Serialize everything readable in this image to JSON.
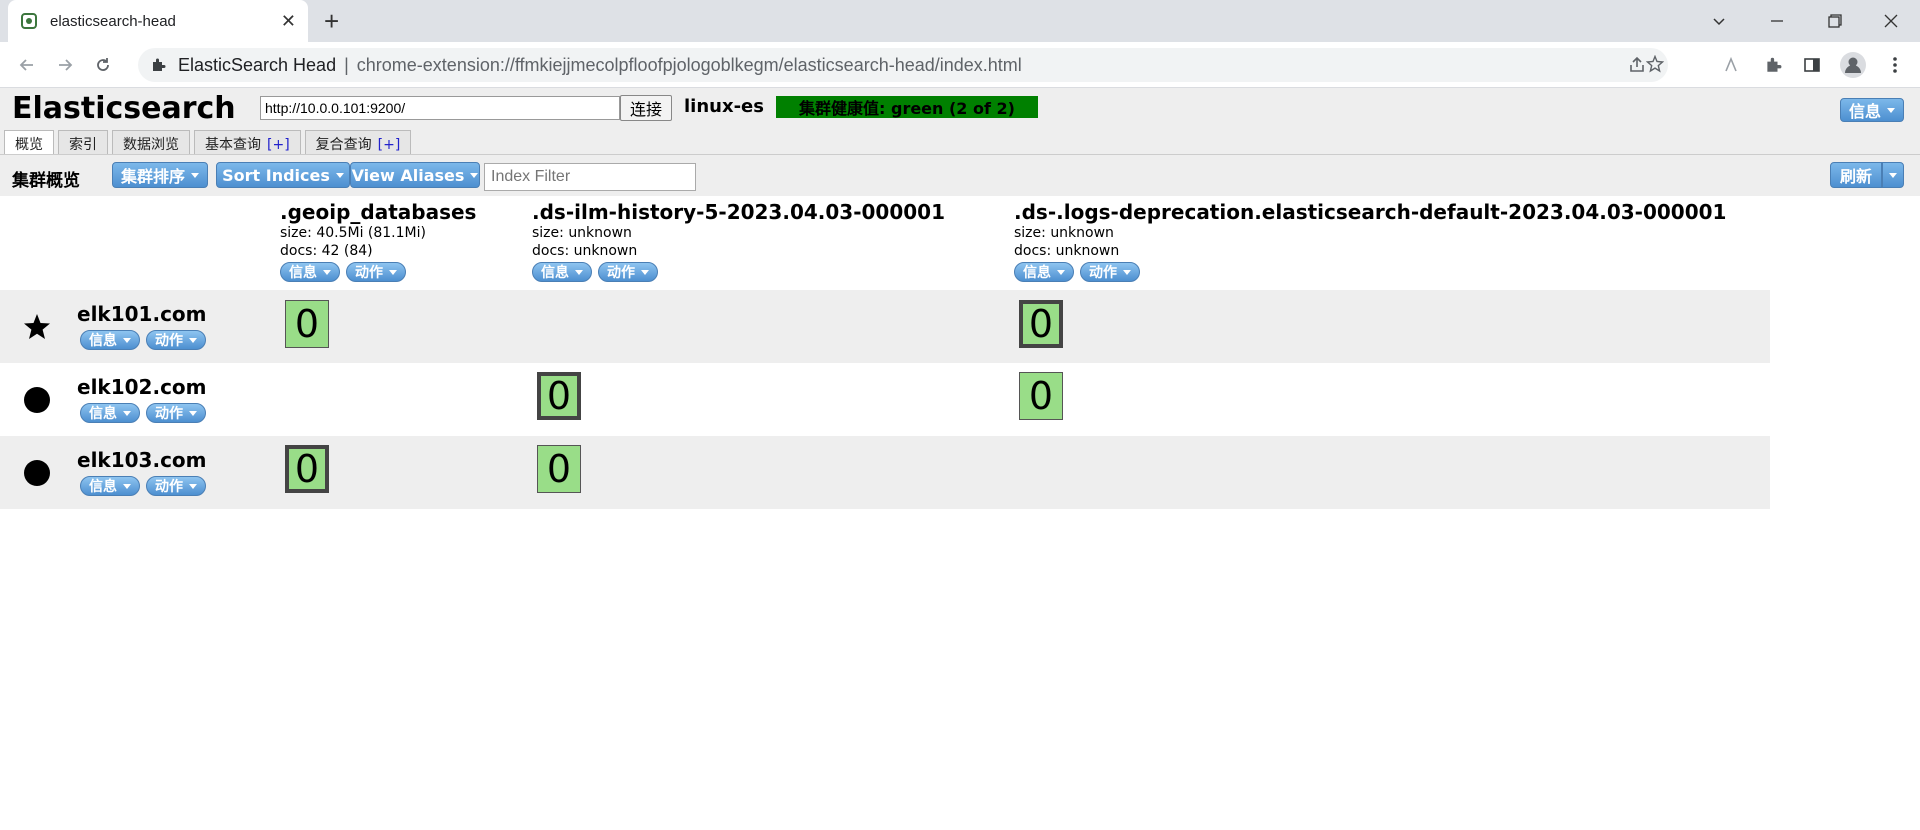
{
  "browser": {
    "tab_title": "elasticsearch-head",
    "site_name": "ElasticSearch Head",
    "url_separator": "|",
    "url": "chrome-extension://ffmkiejjmecolpfloofpjologoblkegm/elasticsearch-head/index.html"
  },
  "app": {
    "title": "Elasticsearch",
    "connect_url": "http://10.0.0.101:9200/",
    "connect_label": "连接",
    "cluster_name": "linux-es",
    "health": "集群健康值: green (2 of 2)",
    "health_color": "#008000",
    "info_label": "信息",
    "tabs": [
      {
        "label": "概览",
        "plus": ""
      },
      {
        "label": "索引",
        "plus": ""
      },
      {
        "label": "数据浏览",
        "plus": ""
      },
      {
        "label": "基本查询",
        "plus": "[+]"
      },
      {
        "label": "复合查询",
        "plus": "[+]"
      }
    ]
  },
  "overview": {
    "title": "集群概览",
    "sort_cluster": "集群排序",
    "sort_indices": "Sort Indices",
    "view_aliases": "View Aliases",
    "filter_placeholder": "Index Filter",
    "refresh": "刷新"
  },
  "buttons": {
    "info": "信息",
    "action": "动作"
  },
  "indices": [
    {
      "name": ".geoip_databases",
      "size": "size: 40.5Mi (81.1Mi)",
      "docs": "docs: 42 (84)"
    },
    {
      "name": ".ds-ilm-history-5-2023.04.03-000001",
      "size": "size: unknown",
      "docs": "docs: unknown"
    },
    {
      "name": ".ds-.logs-deprecation.elasticsearch-default-2023.04.03-000001",
      "size": "size: unknown",
      "docs": "docs: unknown"
    }
  ],
  "nodes": [
    {
      "name": "elk101.com",
      "symbol": "star-icon"
    },
    {
      "name": "elk102.com",
      "symbol": "circle-icon"
    },
    {
      "name": "elk103.com",
      "symbol": "circle-icon"
    }
  ],
  "shards": [
    {
      "node": 0,
      "index": 0,
      "label": "0",
      "primary": false
    },
    {
      "node": 0,
      "index": 2,
      "label": "0",
      "primary": true
    },
    {
      "node": 1,
      "index": 1,
      "label": "0",
      "primary": true
    },
    {
      "node": 1,
      "index": 2,
      "label": "0",
      "primary": false
    },
    {
      "node": 2,
      "index": 0,
      "label": "0",
      "primary": true
    },
    {
      "node": 2,
      "index": 1,
      "label": "0",
      "primary": false
    }
  ],
  "colors": {
    "shard_fill": "#99dd88",
    "button_blue": "#4d8fd0"
  }
}
